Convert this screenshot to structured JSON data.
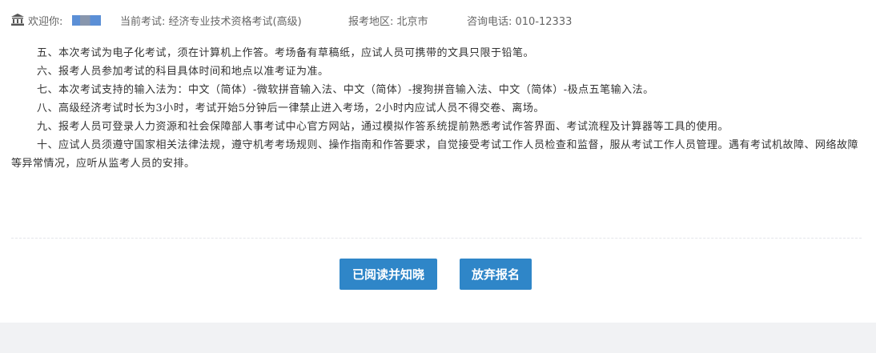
{
  "header": {
    "welcome_label": "欢迎你:",
    "exam_label": "当前考试: 经济专业技术资格考试(高级)",
    "region_label": "报考地区: 北京市",
    "phone_label": "咨询电话: 010-12333"
  },
  "notice": {
    "items": [
      "五、本次考试为电子化考试，须在计算机上作答。考场备有草稿纸，应试人员可携带的文具只限于铅笔。",
      "六、报考人员参加考试的科目具体时间和地点以准考证为准。",
      "七、本次考试支持的输入法为：中文（简体）-微软拼音输入法、中文（简体）-搜狗拼音输入法、中文（简体）-极点五笔输入法。",
      "八、高级经济考试时长为3小时，考试开始5分钟后一律禁止进入考场，2小时内应试人员不得交卷、离场。",
      "九、报考人员可登录人力资源和社会保障部人事考试中心官方网站，通过模拟作答系统提前熟悉考试作答界面、考试流程及计算器等工具的使用。",
      "十、应试人员须遵守国家相关法律法规，遵守机考考场规则、操作指南和作答要求，自觉接受考试工作人员检查和监督，服从考试工作人员管理。遇有考试机故障、网络故障等异常情况，应听从监考人员的安排。"
    ]
  },
  "actions": {
    "read_label": "已阅读并知晓",
    "quit_label": "放弃报名"
  },
  "colors": {
    "button": "#2f86c8",
    "footer": "#f1f2f4"
  },
  "icons": {
    "header": "bank-icon"
  }
}
